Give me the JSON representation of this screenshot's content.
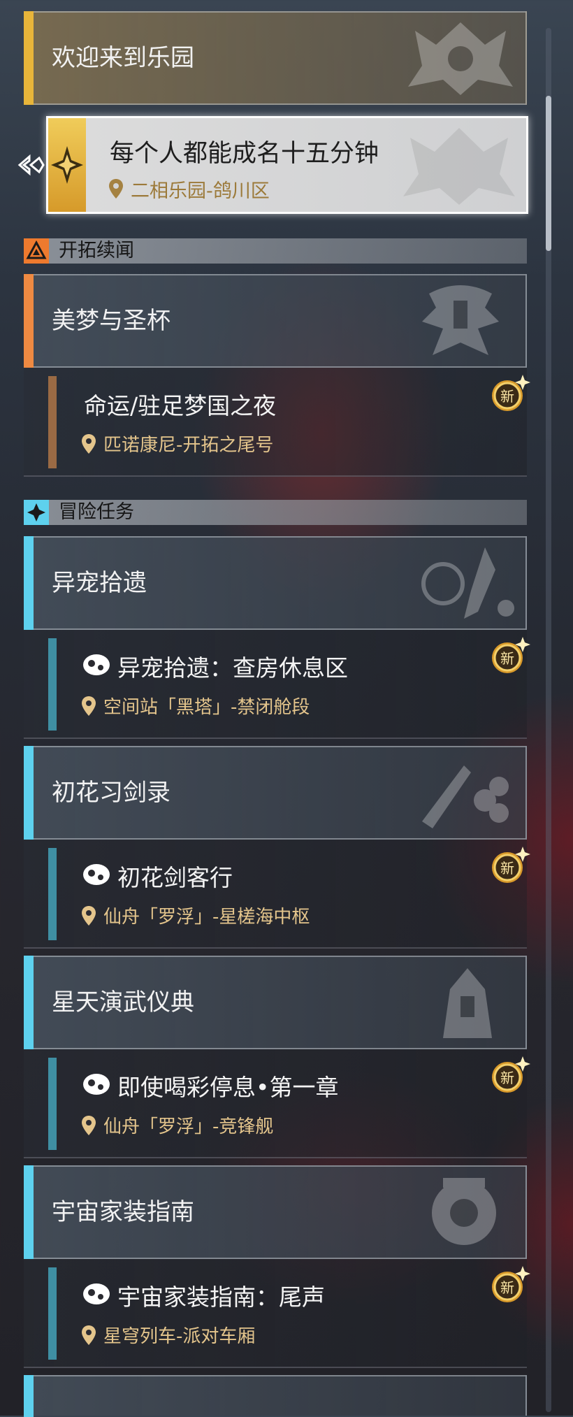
{
  "groups": [
    {
      "title": "欢迎来到乐园",
      "current": {
        "title": "每个人都能成名十五分钟",
        "location": "二相乐园-鸽川区"
      }
    }
  ],
  "sections": {
    "trailblaze": {
      "title": "开拓续闻",
      "group": {
        "title": "美梦与圣杯"
      },
      "quest": {
        "title": "命运/驻足梦国之夜",
        "location": "匹诺康尼-开拓之尾号",
        "badge": "新"
      }
    },
    "adventure": {
      "title": "冒险任务",
      "groups": [
        {
          "title": "异宠拾遗",
          "quest": {
            "title": "异宠拾遗：查房休息区",
            "location": "空间站「黑塔」-禁闭舱段",
            "badge": "新"
          }
        },
        {
          "title": "初花习剑录",
          "quest": {
            "title": "初花剑客行",
            "location": "仙舟「罗浮」-星槎海中枢",
            "badge": "新"
          }
        },
        {
          "title": "星天演武仪典",
          "quest": {
            "title": "即使喝彩停息•第一章",
            "location": "仙舟「罗浮」-竞锋舰",
            "badge": "新"
          }
        },
        {
          "title": "宇宙家装指南",
          "quest": {
            "title": "宇宙家装指南：尾声",
            "location": "星穹列车-派对车厢",
            "badge": "新"
          }
        }
      ]
    }
  },
  "colors": {
    "yellow_accent": "#e8b53a",
    "orange_accent": "#ef8a42",
    "cyan_accent": "#5ed1ee",
    "location_text": "#e4c58c"
  },
  "icons": [
    "pointer-arrow-icon",
    "location-pin-icon",
    "new-badge-icon",
    "adventure-quest-icon",
    "trailblaze-section-icon",
    "adventure-section-icon",
    "quest-emblem-icon"
  ]
}
